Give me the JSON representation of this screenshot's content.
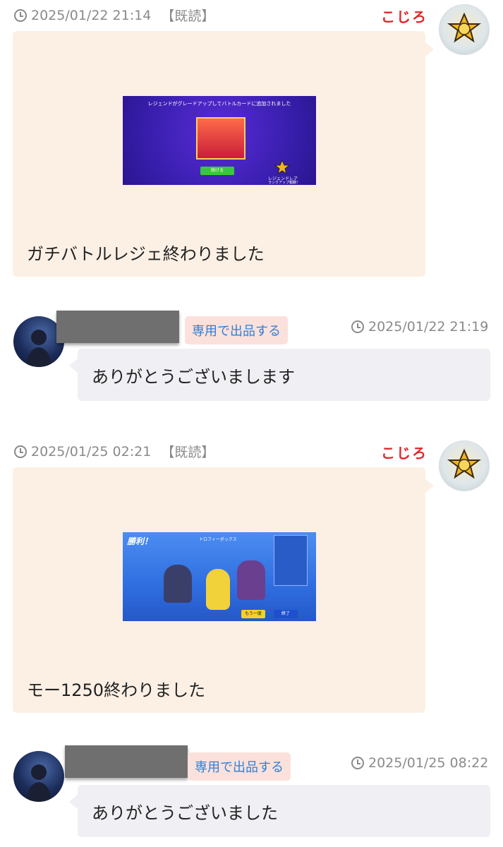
{
  "messages": [
    {
      "timestamp": "2025/01/22 21:14",
      "read_status": "【既読】",
      "sender": "こじろ",
      "text": "ガチバトルレジェ終わりました",
      "screenshot_caption": "レジェンドがグレードアップしてバトルカードに追加されました",
      "screenshot_button": "続ける",
      "screenshot_rank": "レジェンドレア",
      "screenshot_rank_sub": "ランクアップ報酬！"
    },
    {
      "timestamp": "2025/01/22 21:19",
      "tag": "専用で出品する",
      "text": "ありがとうございまします"
    },
    {
      "timestamp": "2025/01/25 02:21",
      "read_status": "【既読】",
      "sender": "こじろ",
      "text": "モー1250終わりました",
      "screenshot_title": "勝利！",
      "screenshot_box": "トロフィーボックス",
      "screenshot_btn_left": "もう一度",
      "screenshot_btn_right": "終了"
    },
    {
      "timestamp": "2025/01/25 08:22",
      "tag": "専用で出品する",
      "text": "ありがとうございました"
    }
  ],
  "colors": {
    "seller_bubble": "#fcf0e5",
    "buyer_bubble": "#efeff4",
    "sender_name": "#e0272a",
    "tag_text": "#2f7fd6",
    "tag_bg": "#fbe1dc"
  }
}
